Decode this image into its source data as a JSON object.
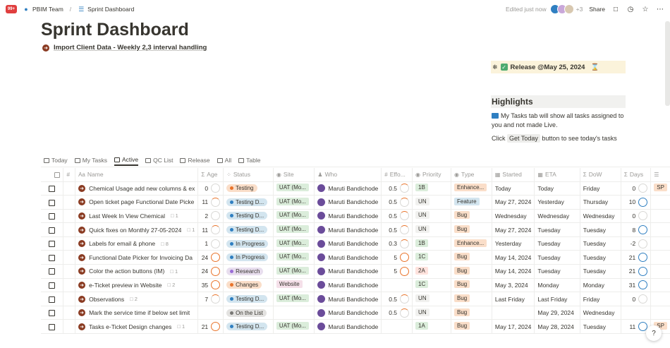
{
  "topbar": {
    "badge": "99+",
    "workspace": "PBIM Team",
    "page": "Sprint Dashboard",
    "edited": "Edited just now",
    "more_count": "+3",
    "share": "Share"
  },
  "page": {
    "title": "Sprint Dashboard",
    "subtitle_link": "Import Client Data - Weekly 2,3 interval handling"
  },
  "release": {
    "label": "Release @May 25, 2024"
  },
  "highlights": {
    "title": "Highlights",
    "line1": "My Tasks tab will show all tasks assigned to you and not made Live.",
    "line2_a": "Click",
    "line2_code": "Get Today",
    "line2_b": "button to see today's tasks"
  },
  "tabs": [
    {
      "label": "Today"
    },
    {
      "label": "My Tasks"
    },
    {
      "label": "Active"
    },
    {
      "label": "QC List"
    },
    {
      "label": "Release"
    },
    {
      "label": "All"
    },
    {
      "label": "Table"
    }
  ],
  "columns": {
    "hash": "#",
    "name": "Name",
    "age": "Age",
    "status": "Status",
    "site": "Site",
    "who": "Who",
    "effort": "Effo...",
    "priority": "Priority",
    "type": "Type",
    "started": "Started",
    "eta": "ETA",
    "dow": "DoW",
    "days": "Days"
  },
  "colors": {
    "orange": "#e9742b",
    "blue": "#2f7fc1",
    "green_tag": "#dbeddb",
    "red_tag": "#ffe2dd"
  },
  "rows": [
    {
      "name": "Chemical Usage add new columns & ex",
      "comments": "",
      "age": "0",
      "status": "Testing",
      "site": "UAT (Mo...",
      "who": "Maruti Bandichode",
      "effort": "0.5",
      "priority": "1B",
      "type": "Enhance...",
      "started": "Today",
      "eta": "Today",
      "dow": "Friday",
      "days": "0",
      "extra": "SP"
    },
    {
      "name": "Open ticket page Functional Date Picke",
      "comments": "",
      "age": "11",
      "status": "Testing D...",
      "site": "UAT (Mo...",
      "who": "Maruti Bandichode",
      "effort": "0.5",
      "priority": "UN",
      "type": "Feature",
      "started": "May 27, 2024",
      "eta": "Yesterday",
      "dow": "Thursday",
      "days": "10",
      "extra": ""
    },
    {
      "name": "Last Week In View Chemical",
      "comments": "1",
      "age": "2",
      "status": "Testing D...",
      "site": "UAT (Mo...",
      "who": "Maruti Bandichode",
      "effort": "0.5",
      "priority": "UN",
      "type": "Bug",
      "started": "Wednesday",
      "eta": "Wednesday",
      "dow": "Wednesday",
      "days": "0",
      "extra": ""
    },
    {
      "name": "Quick fixes on Monthly 27-05-2024",
      "comments": "1",
      "age": "11",
      "status": "Testing D...",
      "site": "UAT (Mo...",
      "who": "Maruti Bandichode",
      "effort": "0.5",
      "priority": "UN",
      "type": "Bug",
      "started": "May 27, 2024",
      "eta": "Tuesday",
      "dow": "Tuesday",
      "days": "8",
      "extra": ""
    },
    {
      "name": "Labels for email & phone",
      "comments": "8",
      "age": "1",
      "status": "In Progress",
      "site": "UAT (Mo...",
      "who": "Maruti Bandichode",
      "effort": "0.3",
      "priority": "1B",
      "type": "Enhance...",
      "started": "Yesterday",
      "eta": "Tuesday",
      "dow": "Tuesday",
      "days": "-2",
      "extra": ""
    },
    {
      "name": "Functional Date Picker for Invoicing Da",
      "comments": "",
      "age": "24",
      "status": "In Progress",
      "site": "UAT (Mo...",
      "who": "Maruti Bandichode",
      "effort": "5",
      "priority": "1C",
      "type": "Bug",
      "started": "May 14, 2024",
      "eta": "Tuesday",
      "dow": "Tuesday",
      "days": "21",
      "extra": ""
    },
    {
      "name": "Color the action buttons (IM)",
      "comments": "1",
      "age": "24",
      "status": "Research",
      "site": "UAT (Mo...",
      "who": "Maruti Bandichode",
      "effort": "5",
      "priority": "2A",
      "type": "Bug",
      "started": "May 14, 2024",
      "eta": "Tuesday",
      "dow": "Tuesday",
      "days": "21",
      "extra": ""
    },
    {
      "name": "e-Ticket preview in Website",
      "comments": "2",
      "age": "35",
      "status": "Changes",
      "site": "Website",
      "who": "Maruti Bandichode",
      "effort": "",
      "priority": "1C",
      "type": "Bug",
      "started": "May 3, 2024",
      "eta": "Monday",
      "dow": "Monday",
      "days": "31",
      "extra": ""
    },
    {
      "name": "Observations",
      "comments": "2",
      "age": "7",
      "status": "Testing D...",
      "site": "UAT (Mo...",
      "who": "Maruti Bandichode",
      "effort": "0.5",
      "priority": "UN",
      "type": "Bug",
      "started": "Last Friday",
      "eta": "Last Friday",
      "dow": "Friday",
      "days": "0",
      "extra": ""
    },
    {
      "name": "Mark the service time if below set limit",
      "comments": "",
      "age": "",
      "status": "On the List",
      "site": "",
      "who": "Maruti Bandichode",
      "effort": "0.5",
      "priority": "UN",
      "type": "Bug",
      "started": "",
      "eta": "May 29, 2024",
      "dow": "Wednesday",
      "days": "",
      "extra": ""
    },
    {
      "name": "Tasks e-Ticket Design changes",
      "comments": "1",
      "age": "21",
      "status": "Testing D...",
      "site": "UAT (Mo...",
      "who": "Maruti Bandichode",
      "effort": "",
      "priority": "1A",
      "type": "Bug",
      "started": "May 17, 2024",
      "eta": "May 28, 2024",
      "dow": "Tuesday",
      "days": "11",
      "extra": "SP"
    }
  ]
}
